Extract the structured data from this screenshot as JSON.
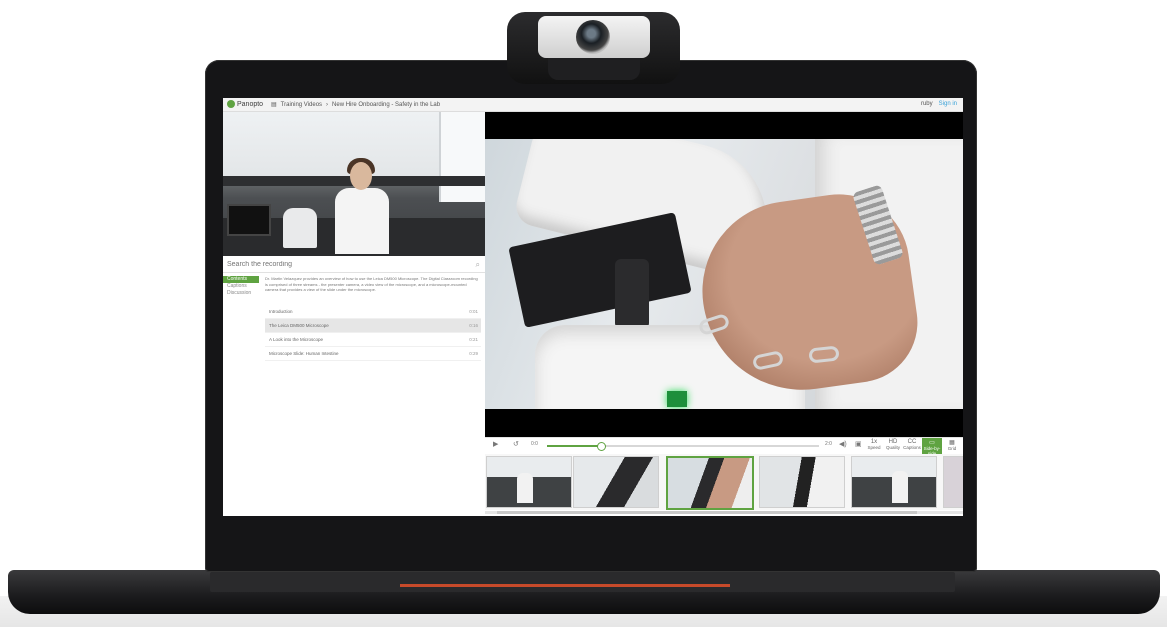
{
  "app": {
    "logo_text": "Panopto",
    "breadcrumb": [
      "Training Videos",
      "New Hire Onboarding - Safety in the Lab"
    ],
    "user_name": "ruby",
    "sign_in": "Sign in"
  },
  "search": {
    "placeholder": "Search the recording"
  },
  "side_tabs": [
    "Contents",
    "Captions",
    "Discussion"
  ],
  "description": "Dr. Martin Velazquez provides an overview of how to use the Leica DM500 Microscope. The Digital Classroom recording is comprised of three streams - the presenter camera, a video view of the microscope, and a microscope-mounted camera that provides a view of the slide under the microscope.",
  "toc": [
    {
      "title": "Introduction",
      "time": "0:01"
    },
    {
      "title": "The Leica DM500 Microscope",
      "time": "0:16"
    },
    {
      "title": "A Look into the Microscope",
      "time": "0:21"
    },
    {
      "title": "Microscope Slide: Human Intestine",
      "time": "0:29"
    }
  ],
  "player": {
    "current_time": "0:0",
    "remaining_time": "2:0",
    "progress": 0.2,
    "buttons": [
      {
        "top": "1x",
        "label": "Speed"
      },
      {
        "top": "HD",
        "label": "Quality"
      },
      {
        "top": "CC",
        "label": "Captions"
      },
      {
        "top": "▭",
        "label": "Side-by-side"
      },
      {
        "top": "▦",
        "label": "Grid"
      }
    ]
  },
  "colors": {
    "accent": "#5fa341",
    "link": "#3aa2d8"
  }
}
